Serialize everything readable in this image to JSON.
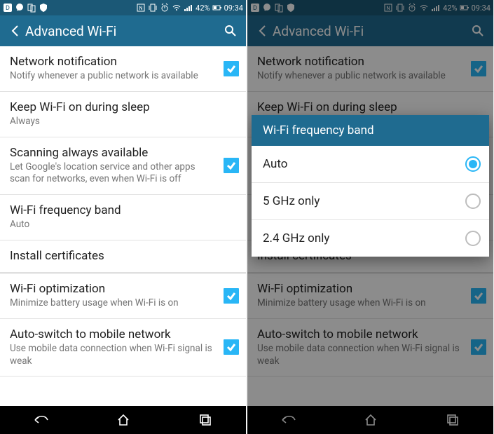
{
  "status": {
    "battery": "42%",
    "time": "09:34"
  },
  "appbar": {
    "title": "Advanced Wi-Fi"
  },
  "items": {
    "network_notification": {
      "title": "Network notification",
      "sub": "Notify whenever a public network is available"
    },
    "keep_on": {
      "title": "Keep Wi-Fi on during sleep",
      "sub": "Always"
    },
    "scanning": {
      "title": "Scanning always available",
      "sub": "Let Google's location service and other apps scan for networks, even when Wi-Fi is off"
    },
    "freq": {
      "title": "Wi-Fi frequency band",
      "sub": "Auto"
    },
    "install": {
      "title": "Install certificates"
    },
    "optimize": {
      "title": "Wi-Fi optimization",
      "sub": "Minimize battery usage when Wi-Fi is on"
    },
    "autoswitch": {
      "title": "Auto-switch to mobile network",
      "sub": "Use mobile data connection when Wi-Fi signal is weak"
    }
  },
  "dialog": {
    "title": "Wi-Fi frequency band",
    "opt1": "Auto",
    "opt2": "5 GHz only",
    "opt3": "2.4 GHz only"
  }
}
